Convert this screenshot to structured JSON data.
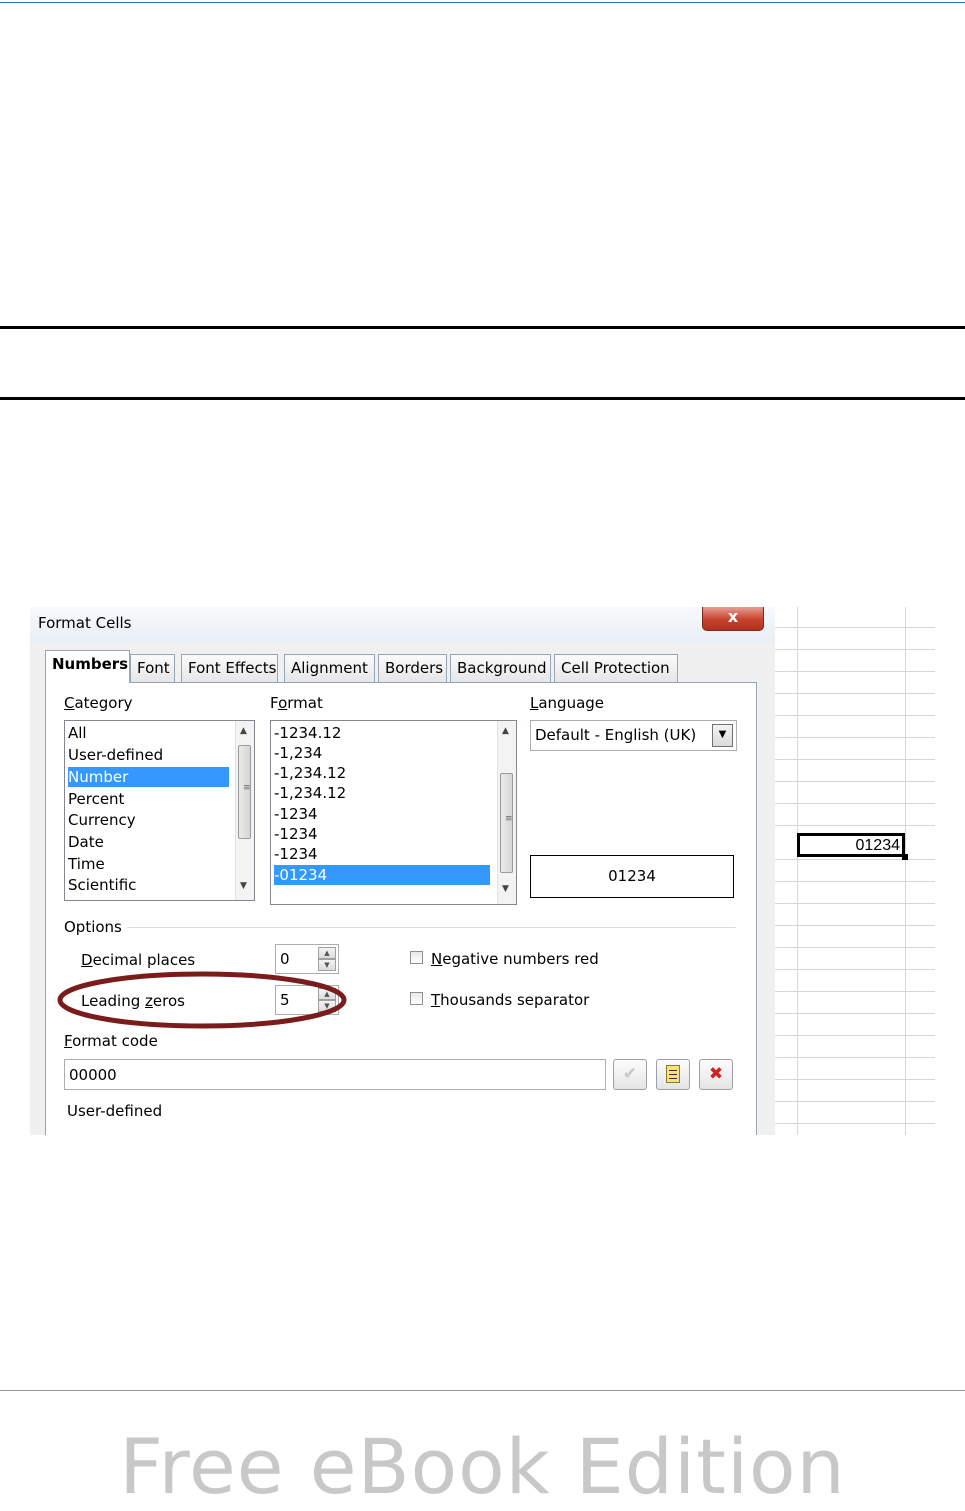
{
  "dialog": {
    "title": "Format Cells",
    "close_label": "x",
    "tabs": [
      "Numbers",
      "Font",
      "Font Effects",
      "Alignment",
      "Borders",
      "Background",
      "Cell Protection"
    ],
    "active_tab": "Numbers",
    "category": {
      "label": "Category",
      "items": [
        "All",
        "User-defined",
        "Number",
        "Percent",
        "Currency",
        "Date",
        "Time",
        "Scientific"
      ],
      "selected": "Number"
    },
    "format": {
      "label": "Format",
      "items": [
        "-1234.12",
        "-1,234",
        "-1,234.12",
        "-1,234.12",
        "-1234",
        "-1234",
        "-1234",
        "-01234"
      ],
      "selected": "-01234"
    },
    "language": {
      "label": "Language",
      "value": "Default - English (UK)"
    },
    "preview": "01234",
    "options": {
      "label": "Options",
      "decimal_places_label": "Decimal places",
      "decimal_places_value": "0",
      "leading_zeros_label": "Leading zeros",
      "leading_zeros_value": "5",
      "negative_red_label": "Negative numbers red",
      "negative_red_checked": false,
      "thousands_label": "Thousands separator",
      "thousands_checked": false
    },
    "format_code": {
      "label": "Format code",
      "value": "00000",
      "description": "User-defined"
    }
  },
  "sheet": {
    "cell_value": "01234"
  },
  "highlight_color": "#7b1c1c",
  "footer": {
    "watermark": "Free eBook Edition"
  }
}
